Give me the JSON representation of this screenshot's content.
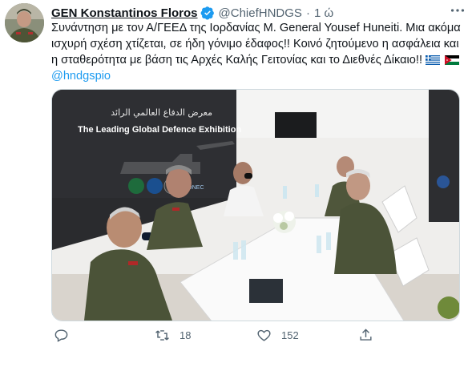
{
  "tweet": {
    "display_name": "GEN Konstantinos Floros",
    "handle": "@ChiefHNDGS",
    "separator": "·",
    "time": "1 ώ",
    "text_main": "Συνάντηση με τον Α/ΓΕΕΔ της Ιορδανίας M. General Yousef Huneiti. Μια ακόμα ισχυρή σχέση χτίζεται, σε ήδη γόνιμο έδαφος!! Κοινό ζητούμενο η ασφάλεια και η σταθερότητα με βάση τις Αρχές Καλής Γειτονίας και το Διεθνές Δίκαιο!!",
    "mention": "@hndgspio",
    "flags": [
      "greece-flag",
      "jordan-flag"
    ]
  },
  "photo": {
    "banner_arabic": "معرض الدفاع العالمي الرائد",
    "banner_english": "The Leading Global Defence Exhibition",
    "adnec_label": "ADNEC"
  },
  "actions": {
    "reply_count": "",
    "retweet_count": "18",
    "like_count": "152",
    "share_count": ""
  },
  "colors": {
    "link": "#1d9bf0",
    "secondary_text": "#536471",
    "verified_badge": "#1d9bf0"
  }
}
